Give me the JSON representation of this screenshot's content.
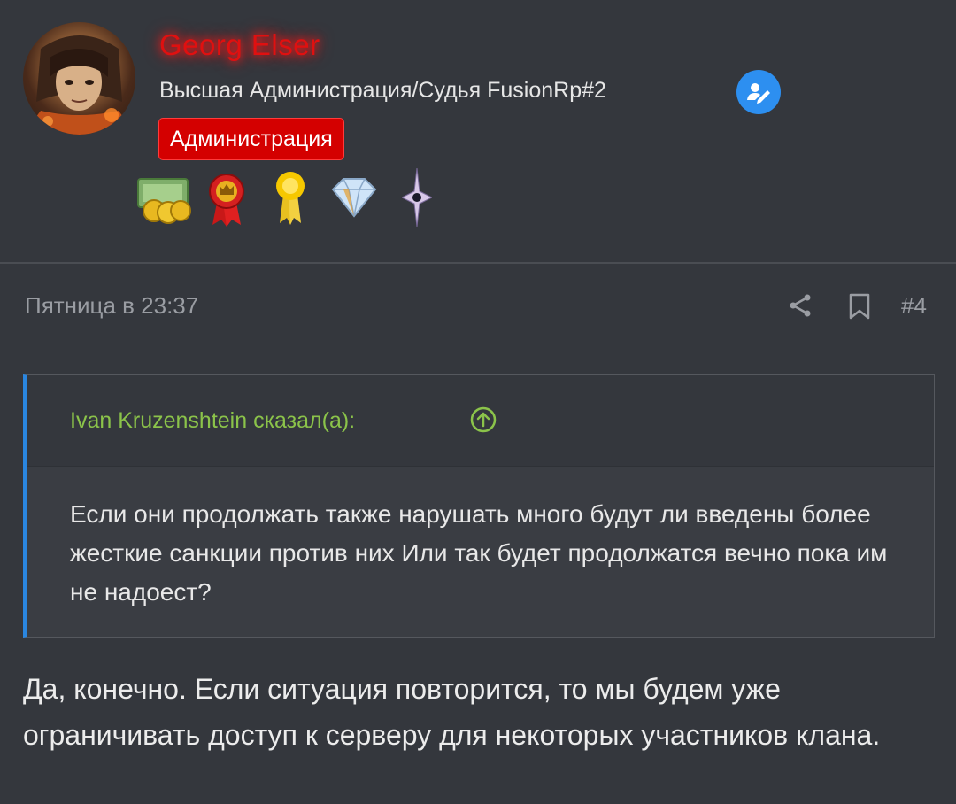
{
  "author": {
    "name": "Georg Elser",
    "title": "Высшая Администрация/Судья FusionRp#2",
    "role_badge": "Администрация",
    "awards": [
      "money-award-icon",
      "crown-ribbon-award-icon",
      "sun-ribbon-award-icon",
      "diamond-award-icon",
      "star-award-icon"
    ]
  },
  "post": {
    "date": "Пятница в 23:37",
    "number": "#4"
  },
  "quote": {
    "author_line": "Ivan Kruzenshtein сказал(а):",
    "text": "Если они продолжать также нарушать много будут ли введены более жесткие санкции против них Или так будет продолжатся вечно пока им не надоест?"
  },
  "reply": {
    "text": "Да, конечно. Если ситуация повторится, то мы будем уже ограничивать доступ к серверу для некоторых участников клана."
  },
  "colors": {
    "background": "#34373d",
    "username": "#e01010",
    "badge": "#d40000",
    "quote_author": "#8bc34a",
    "quote_bar": "#2a86e0",
    "verify": "#2d8ff0"
  }
}
